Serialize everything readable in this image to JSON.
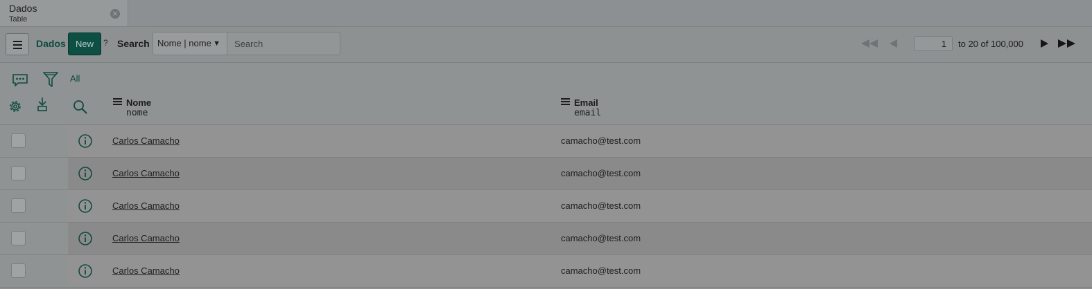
{
  "tab": {
    "title": "Dados",
    "subtitle": "Table",
    "close_glyph": "×"
  },
  "toolbar": {
    "list_title": "Dados",
    "new_label": "New",
    "help_glyph": "?",
    "search_label": "Search",
    "search_field": "Nome | nome",
    "search_placeholder": "Search",
    "page_value": "1",
    "page_range": "to 20 of 100,000"
  },
  "filter": {
    "all_label": "All"
  },
  "columns": [
    {
      "title": "Nome",
      "field": "nome"
    },
    {
      "title": "Email",
      "field": "email"
    }
  ],
  "rows": [
    {
      "name": "Carlos Camacho",
      "email": "camacho@test.com"
    },
    {
      "name": "Carlos Camacho",
      "email": "camacho@test.com"
    },
    {
      "name": "Carlos Camacho",
      "email": "camacho@test.com"
    },
    {
      "name": "Carlos Camacho",
      "email": "camacho@test.com"
    },
    {
      "name": "Carlos Camacho",
      "email": "camacho@test.com"
    }
  ],
  "icons": {
    "menu": "hamburger-icon",
    "first_page": "double-left-arrow-icon",
    "prev_page": "left-arrow-icon",
    "next_page": "right-arrow-icon",
    "last_page": "double-right-arrow-icon",
    "activity": "chat-bubble-icon",
    "filter": "funnel-icon",
    "settings": "gear-icon",
    "export": "download-icon",
    "search": "search-icon",
    "info": "info-circle-icon"
  },
  "colors": {
    "accent": "#0d4f43",
    "accent_text": "#0e4a3e",
    "overlay_gray": "#8f8f8f"
  }
}
